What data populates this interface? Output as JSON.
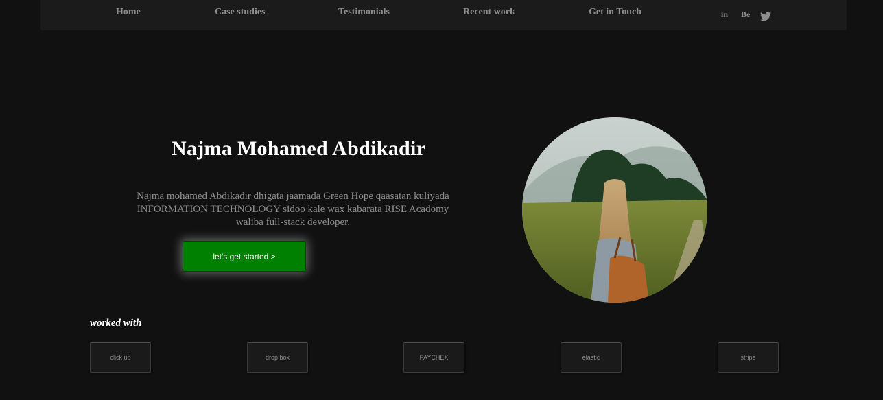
{
  "nav": {
    "links": [
      "Home",
      "Case studies",
      "Testimonials",
      "Recent work",
      "Get in Touch"
    ],
    "social": {
      "linkedin": "in",
      "behance": "Be",
      "twitter_icon": "twitter-icon"
    }
  },
  "hero": {
    "title": "Najma Mohamed Abdikadir",
    "description": "Najma mohamed Abdikadir dhigata jaamada Green Hope qaasatan kuliyada INFORMATION TECHNOLOGY sidoo kale wax kabarata RISE Acadomy waliba full-stack developer.",
    "cta_label": "let's get started >",
    "cta_color": "#008000"
  },
  "worked_with": {
    "label": "worked with",
    "brands": [
      "click up",
      "drop box",
      "PAYCHEX",
      "elastic",
      "stripe"
    ]
  },
  "colors": {
    "background": "#111111",
    "navbar": "#1c1b1c",
    "accent": "#008000"
  }
}
